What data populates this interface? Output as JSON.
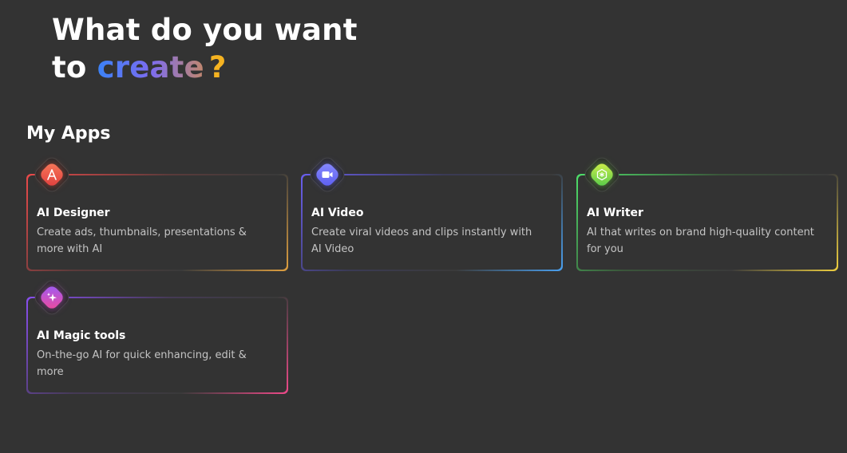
{
  "hero": {
    "line1": "What do you want",
    "line2_prefix": "to",
    "line2_highlight": "create",
    "line2_suffix": "?"
  },
  "section": {
    "title": "My Apps"
  },
  "apps": [
    {
      "title": "AI Designer",
      "description": "Create ads, thumbnails, presentations & more with AI",
      "icon": "designer-icon"
    },
    {
      "title": "AI Video",
      "description": "Create viral videos and clips instantly with AI Video",
      "icon": "video-camera-icon"
    },
    {
      "title": "AI Writer",
      "description": "AI that writes on brand high-quality content for you",
      "icon": "writer-icon"
    },
    {
      "title": "AI Magic tools",
      "description": "On-the-go AI for quick enhancing, edit & more",
      "icon": "sparkles-icon"
    }
  ],
  "colors": {
    "background": "#333333",
    "highlight_gradient": [
      "#3b82f6",
      "#7c6cf0",
      "#c2876c"
    ],
    "question_mark": "#f5b321"
  }
}
